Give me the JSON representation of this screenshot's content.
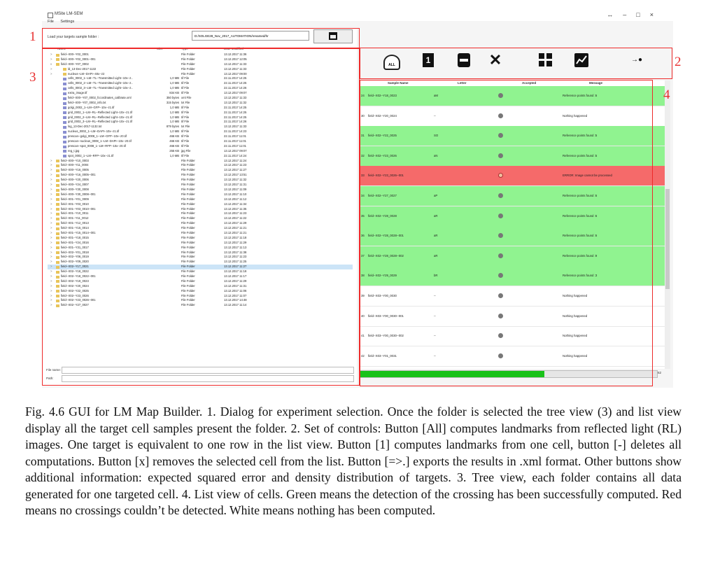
{
  "window": {
    "title": "MSite LM-SEM",
    "menu": [
      "File",
      "Settings"
    ],
    "controls": [
      "↔",
      "–",
      "□",
      "×"
    ]
  },
  "load": {
    "label": "Load your targets sample folder :",
    "path": "D:/SOLGE28_Nov_2017_AUTOMATION/renamed/hr"
  },
  "tree": {
    "headers": [
      "Name",
      "Size",
      "Type",
      "Date Modified"
    ],
    "rows": [
      {
        "name": "field--X00--Y02_0001",
        "size": "",
        "type": "File Folder",
        "date": "13.12.2017 11:36",
        "depth": 0,
        "kind": "folder",
        "exp": ">"
      },
      {
        "name": "field--X00--Y02_0001--001",
        "size": "",
        "type": "File Folder",
        "date": "13.12.2017 12:05",
        "depth": 0,
        "kind": "folder",
        "exp": ">"
      },
      {
        "name": "field--X00--Y07_0002",
        "size": "",
        "type": "File Folder",
        "date": "13.12.2017 11:33",
        "depth": 0,
        "kind": "folder",
        "exp": "v"
      },
      {
        "name": "ld_13-Dec-2017-1132",
        "size": "",
        "type": "File Folder",
        "date": "13.12.2017 11:33",
        "depth": 1,
        "kind": "folder",
        "exp": ">"
      },
      {
        "name": "nucleus--LM--DAPI--40x--z2",
        "size": "",
        "type": "File Folder",
        "date": "13.12.2017 09:00",
        "depth": 1,
        "kind": "folder",
        "exp": ">"
      },
      {
        "name": "cells_0002_1--LM--TL--Transmitted Light--10x--z..",
        "size": "1,0 MB",
        "type": "tif File",
        "date": "22.11.2017 14:25",
        "depth": 1,
        "kind": "file",
        "exp": ""
      },
      {
        "name": "cells_0002_2--LM--TL--Transmitted Light--10x--z..",
        "size": "1,0 MB",
        "type": "tif File",
        "date": "22.11.2017 14:25",
        "depth": 1,
        "kind": "file",
        "exp": ""
      },
      {
        "name": "cells_0002_3--LM--TL--Transmitted Light--10x--z..",
        "size": "1,0 MB",
        "type": "tif File",
        "date": "22.11.2017 14:26",
        "depth": 1,
        "kind": "file",
        "exp": ""
      },
      {
        "name": "extra_image.tif",
        "size": "834 KB",
        "type": "tif File",
        "date": "13.12.2017 09:07",
        "depth": 1,
        "kind": "file",
        "exp": ""
      },
      {
        "name": "field--X00--Y07_0002_fccordinates_calibrate.xml",
        "size": "350 bytes",
        "type": "xml File",
        "date": "13.12.2017 11:33",
        "depth": 1,
        "kind": "file",
        "exp": ""
      },
      {
        "name": "field--X00--Y07_0002_info.txt",
        "size": "315 bytes",
        "type": "txt File",
        "date": "13.12.2017 11:32",
        "depth": 1,
        "kind": "file",
        "exp": ""
      },
      {
        "name": "golgi_0002_1--LM--GFP--10x--z1.tif",
        "size": "1,0 MB",
        "type": "tif File",
        "date": "22.11.2017 14:25",
        "depth": 1,
        "kind": "file",
        "exp": ""
      },
      {
        "name": "grid_0002_1--LM--RL--Reflected Light--10x--z1.tif",
        "size": "1,0 MB",
        "type": "tif File",
        "date": "22.11.2017 14:25",
        "depth": 1,
        "kind": "file",
        "exp": ""
      },
      {
        "name": "grid_0002_2--LM--RL--Reflected Light--10x--z1.tif",
        "size": "1,0 MB",
        "type": "tif File",
        "date": "22.11.2017 14:25",
        "depth": 1,
        "kind": "file",
        "exp": ""
      },
      {
        "name": "grid_0002_3--LM--RL--Reflected Light--10x--z1.tif",
        "size": "1,0 MB",
        "type": "tif File",
        "date": "22.11.2017 14:26",
        "depth": 1,
        "kind": "file",
        "exp": ""
      },
      {
        "name": "log_13-Dec-2017-1132.txt",
        "size": "879 bytes",
        "type": "txt File",
        "date": "13.12.2017 11:33",
        "depth": 1,
        "kind": "file",
        "exp": ""
      },
      {
        "name": "nucleus_0002_1--LM--DAPI--10x--z1.tif",
        "size": "1,0 MB",
        "type": "tif File",
        "date": "22.11.2017 14:23",
        "depth": 1,
        "kind": "file",
        "exp": ""
      },
      {
        "name": "prescan--golgi_0008_1--LM--GFP--10x--z0.tif",
        "size": "466 KB",
        "type": "tif File",
        "date": "22.11.2017 11:01",
        "depth": 1,
        "kind": "file",
        "exp": ""
      },
      {
        "name": "prescan--nucleus_0008_1--LM--DAPI--10x--z0.tif",
        "size": "466 KB",
        "type": "tif File",
        "date": "22.11.2017 11:01",
        "depth": 1,
        "kind": "file",
        "exp": ""
      },
      {
        "name": "prescan--spot_0008_1--LM--RFP--10x--z0.tif",
        "size": "466 KB",
        "type": "tif File",
        "date": "22.11.2017 11:01",
        "depth": 1,
        "kind": "file",
        "exp": ""
      },
      {
        "name": "reg_t.jpg",
        "size": "255 KB",
        "type": "jpg File",
        "date": "13.12.2017 09:07",
        "depth": 1,
        "kind": "file",
        "exp": ""
      },
      {
        "name": "spot_0002_1--LM--RFP--10x--z1.tif",
        "size": "1,0 MB",
        "type": "tif File",
        "date": "22.11.2017 14:24",
        "depth": 1,
        "kind": "file",
        "exp": ""
      },
      {
        "name": "field--X00--Y10_0003",
        "size": "",
        "type": "File Folder",
        "date": "13.12.2017 11:24",
        "depth": 0,
        "kind": "folder",
        "exp": ">"
      },
      {
        "name": "field--X00--Y11_0004",
        "size": "",
        "type": "File Folder",
        "date": "13.12.2017 11:23",
        "depth": 0,
        "kind": "folder",
        "exp": ">"
      },
      {
        "name": "field--X00--Y16_0005",
        "size": "",
        "type": "File Folder",
        "date": "13.12.2017 11:27",
        "depth": 0,
        "kind": "folder",
        "exp": ">"
      },
      {
        "name": "field--X00--Y16_0005--001",
        "size": "",
        "type": "File Folder",
        "date": "13.12.2017 13:51",
        "depth": 0,
        "kind": "folder",
        "exp": ">"
      },
      {
        "name": "field--X00--Y20_0006",
        "size": "",
        "type": "File Folder",
        "date": "13.12.2017 11:32",
        "depth": 0,
        "kind": "folder",
        "exp": ">"
      },
      {
        "name": "field--X00--Y24_0007",
        "size": "",
        "type": "File Folder",
        "date": "13.12.2017 11:31",
        "depth": 0,
        "kind": "folder",
        "exp": ">"
      },
      {
        "name": "field--X00--Y30_0008",
        "size": "",
        "type": "File Folder",
        "date": "13.12.2017 11:09",
        "depth": 0,
        "kind": "folder",
        "exp": ">"
      },
      {
        "name": "field--X00--Y30_0008--001",
        "size": "",
        "type": "File Folder",
        "date": "13.12.2017 11:10",
        "depth": 0,
        "kind": "folder",
        "exp": ">"
      },
      {
        "name": "field--X01--Y01_0009",
        "size": "",
        "type": "File Folder",
        "date": "13.12.2017 11:12",
        "depth": 0,
        "kind": "folder",
        "exp": ">"
      },
      {
        "name": "field--X01--Y03_0010",
        "size": "",
        "type": "File Folder",
        "date": "13.12.2017 11:34",
        "depth": 0,
        "kind": "folder",
        "exp": ">"
      },
      {
        "name": "field--X01--Y03_0010--001",
        "size": "",
        "type": "File Folder",
        "date": "13.12.2017 11:35",
        "depth": 0,
        "kind": "folder",
        "exp": ">"
      },
      {
        "name": "field--X01--Y10_0011",
        "size": "",
        "type": "File Folder",
        "date": "13.12.2017 11:23",
        "depth": 0,
        "kind": "folder",
        "exp": ">"
      },
      {
        "name": "field--X01--Y11_0012",
        "size": "",
        "type": "File Folder",
        "date": "13.12.2017 11:22",
        "depth": 0,
        "kind": "folder",
        "exp": ">"
      },
      {
        "name": "field--X01--Y12_0013",
        "size": "",
        "type": "File Folder",
        "date": "13.12.2017 11:29",
        "depth": 0,
        "kind": "folder",
        "exp": ">"
      },
      {
        "name": "field--X01--Y15_0014",
        "size": "",
        "type": "File Folder",
        "date": "13.12.2017 11:21",
        "depth": 0,
        "kind": "folder",
        "exp": ">"
      },
      {
        "name": "field--X01--Y15_0014--001",
        "size": "",
        "type": "File Folder",
        "date": "13.12.2017 11:21",
        "depth": 0,
        "kind": "folder",
        "exp": ">"
      },
      {
        "name": "field--X01--Y18_0015",
        "size": "",
        "type": "File Folder",
        "date": "13.12.2017 11:18",
        "depth": 0,
        "kind": "folder",
        "exp": ">"
      },
      {
        "name": "field--X01--Y24_0016",
        "size": "",
        "type": "File Folder",
        "date": "13.12.2017 11:29",
        "depth": 0,
        "kind": "folder",
        "exp": ">"
      },
      {
        "name": "field--X01--Y31_0017",
        "size": "",
        "type": "File Folder",
        "date": "13.12.2017 11:13",
        "depth": 0,
        "kind": "folder",
        "exp": ">"
      },
      {
        "name": "field--X02--Y01_0018",
        "size": "",
        "type": "File Folder",
        "date": "13.12.2017 11:38",
        "depth": 0,
        "kind": "folder",
        "exp": ">"
      },
      {
        "name": "field--X02--Y06_0019",
        "size": "",
        "type": "File Folder",
        "date": "13.12.2017 11:23",
        "depth": 0,
        "kind": "folder",
        "exp": ">"
      },
      {
        "name": "field--X02--Y09_0020",
        "size": "",
        "type": "File Folder",
        "date": "13.12.2017 11:25",
        "depth": 0,
        "kind": "folder",
        "exp": ">"
      },
      {
        "name": "field--X02--Y17_0021",
        "size": "",
        "type": "File Folder",
        "date": "13.12.2017 11:27",
        "depth": 0,
        "kind": "folder",
        "exp": ">",
        "sel": true
      },
      {
        "name": "field--X02--Y18_0022",
        "size": "",
        "type": "File Folder",
        "date": "13.12.2017 11:18",
        "depth": 0,
        "kind": "folder",
        "exp": ">"
      },
      {
        "name": "field--X02--Y18_0022--001",
        "size": "",
        "type": "File Folder",
        "date": "13.12.2017 11:17",
        "depth": 0,
        "kind": "folder",
        "exp": ">"
      },
      {
        "name": "field--X02--Y19_0023",
        "size": "",
        "type": "File Folder",
        "date": "13.12.2017 11:29",
        "depth": 0,
        "kind": "folder",
        "exp": ">"
      },
      {
        "name": "field--X02--Y20_0024",
        "size": "",
        "type": "File Folder",
        "date": "13.12.2017 11:31",
        "depth": 0,
        "kind": "folder",
        "exp": ">"
      },
      {
        "name": "field--X02--Y22_0025",
        "size": "",
        "type": "File Folder",
        "date": "13.12.2017 11:06",
        "depth": 0,
        "kind": "folder",
        "exp": ">"
      },
      {
        "name": "field--X02--Y23_0026",
        "size": "",
        "type": "File Folder",
        "date": "13.12.2017 11:07",
        "depth": 0,
        "kind": "folder",
        "exp": ">"
      },
      {
        "name": "field--X02--Y23_0026--001",
        "size": "",
        "type": "File Folder",
        "date": "13.12.2017 14:48",
        "depth": 0,
        "kind": "folder",
        "exp": ">"
      },
      {
        "name": "field--X02--Y27_0027",
        "size": "",
        "type": "File Folder",
        "date": "13.12.2017 11:14",
        "depth": 0,
        "kind": "folder",
        "exp": ">"
      }
    ],
    "file_name_label": "File name:",
    "path_label": "Path:"
  },
  "toolbar": {
    "all_label": "ALL",
    "one_label": "1",
    "remove_label": "✕",
    "export_label": "→●"
  },
  "list": {
    "headers": [
      "Sample Name",
      "Letter",
      "Accepted",
      "Message"
    ],
    "rows": [
      {
        "idx": "24",
        "name": "field--X02--Y18_0023",
        "letter": "aM",
        "status": "green",
        "message": "Reference points found :6"
      },
      {
        "idx": "30",
        "name": "field--X02--Y20_0024",
        "letter": "--",
        "status": "white",
        "message": "Nothing happened"
      },
      {
        "idx": "31",
        "name": "field--X02--Y22_0025",
        "letter": "SO",
        "status": "green",
        "message": "Reference points found :5"
      },
      {
        "idx": "32",
        "name": "field--X02--Y23_0026",
        "letter": "aN",
        "status": "green",
        "message": "Reference points found :5"
      },
      {
        "idx": "33",
        "name": "field--X02--Y23_0026--001",
        "letter": "",
        "status": "red",
        "message": "ERROR: Image cannot be processed"
      },
      {
        "idx": "34",
        "name": "field--X02--Y27_0027",
        "letter": "aP",
        "status": "green",
        "message": "Reference points found :6"
      },
      {
        "idx": "35",
        "name": "field--X02--Y28_0028",
        "letter": "aR",
        "status": "green",
        "message": "Reference points found :6"
      },
      {
        "idx": "36",
        "name": "field--X02--Y28_0028--001",
        "letter": "aR",
        "status": "green",
        "message": "Reference points found :6"
      },
      {
        "idx": "37",
        "name": "field--X02--Y28_0028--002",
        "letter": "aR",
        "status": "green",
        "message": "Reference points found :9"
      },
      {
        "idx": "38",
        "name": "field--X02--Y29_0029",
        "letter": "bR",
        "status": "green",
        "message": "Reference points found :3"
      },
      {
        "idx": "39",
        "name": "field--X03--Y00_0030",
        "letter": "--",
        "status": "white",
        "message": "Nothing happened"
      },
      {
        "idx": "40",
        "name": "field--X03--Y00_0030--001",
        "letter": "--",
        "status": "white",
        "message": "Nothing happened"
      },
      {
        "idx": "41",
        "name": "field--X03--Y00_0030--002",
        "letter": "--",
        "status": "white",
        "message": "Nothing happened"
      },
      {
        "idx": "42",
        "name": "field--X03--Y01_0031",
        "letter": "--",
        "status": "white",
        "message": "Nothing happened"
      }
    ]
  },
  "progress": {
    "fraction": 0.62,
    "text": "62"
  },
  "colors": {
    "accepted_green": "#90f390",
    "error_red": "#f56a6a",
    "annotation_red": "#e83030",
    "progress_green": "#19c219"
  },
  "annotations": [
    "1",
    "2",
    "3",
    "4"
  ],
  "caption": "Fig. 4.6 GUI for LM Map Builder. 1. Dialog for experiment selection. Once the folder is selected the tree view (3) and list view display all the target cell samples present the folder. 2. Set of controls: Button [All] computes landmarks from reflected light (RL) images. One target is equivalent to one row in the list view. Button [1] computes landmarks from one cell, button [-] deletes all computations. Button [x] removes the selected cell from the list. Button [=>.] exports the results in .xml format. Other buttons show additional information: expected squared error and density distribution of targets. 3. Tree view, each folder contains all data generated for one targeted cell. 4. List view of cells. Green means the detection of the crossing has been successfully computed. Red means no crossings couldn’t be detected. White means nothing has been computed."
}
